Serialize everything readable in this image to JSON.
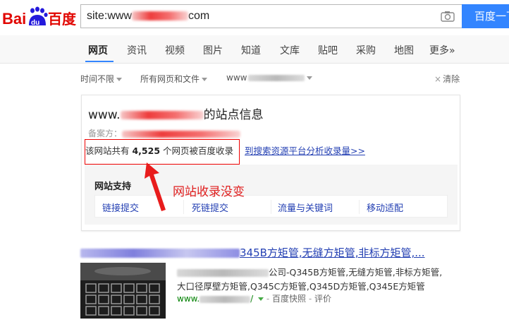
{
  "header": {
    "logo_text_left": "Bai",
    "logo_text_paw": "du",
    "logo_text_right": "百度",
    "query_prefix": "site:www",
    "query_suffix": "com",
    "search_button": "百度一下"
  },
  "nav": {
    "tabs": [
      "网页",
      "资讯",
      "视频",
      "图片",
      "知道",
      "文库",
      "贴吧",
      "采购",
      "地图",
      "更多»"
    ]
  },
  "filters": {
    "time": "时间不限",
    "type": "所有网页和文件",
    "site_prefix": "www",
    "clear": "清除"
  },
  "site_card": {
    "title_prefix": "www.",
    "title_suffix": "的站点信息",
    "icp_label": "备案方：",
    "count_prefix": "该网站共有 ",
    "count_value": "4,525",
    "count_suffix": " 个网页被百度收录",
    "analyze_link": "到搜索资源平台分析收录量>>",
    "support_title": "网站支持",
    "support_items": [
      "链接提交",
      "死链提交",
      "流量与关键词",
      "移动适配"
    ]
  },
  "annotation": {
    "text": "网站收录没变",
    "color": "#e02020"
  },
  "result": {
    "title_visible": "345B方矩管,无缝方矩管,非标方矩管,...",
    "snippet_line1": "公司-Q345B方矩管,无缝方矩管,非标方矩管,",
    "snippet_line2": "大口径厚壁方矩管,Q345C方矩管,Q345D方矩管,Q345E方矩管",
    "url_prefix": "www.",
    "url_suffix": "/",
    "snapshot": "百度快照",
    "review": "评价"
  },
  "colors": {
    "brand_blue": "#3385ff",
    "link_blue": "#2440b3",
    "url_green": "#008000",
    "annotation_red": "#e02020"
  }
}
